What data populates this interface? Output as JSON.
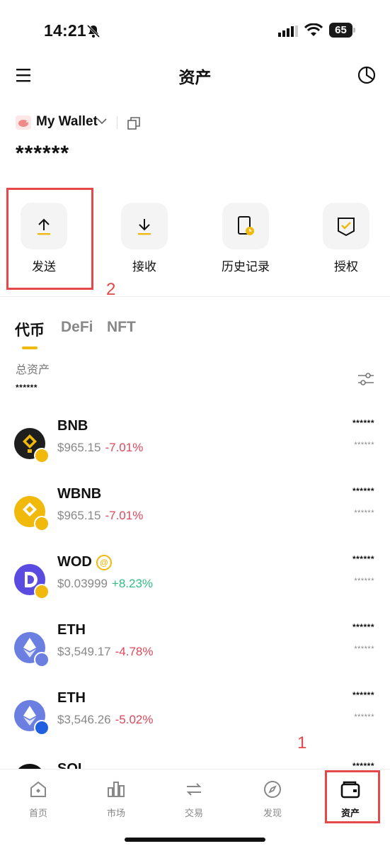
{
  "status_bar": {
    "time": "14:21",
    "battery": "65"
  },
  "header": {
    "title": "资产"
  },
  "wallet": {
    "name": "My Wallet",
    "balance": "******"
  },
  "actions": [
    {
      "label": "发送",
      "icon": "arrow-up-icon"
    },
    {
      "label": "接收",
      "icon": "arrow-down-icon"
    },
    {
      "label": "历史记录",
      "icon": "history-icon"
    },
    {
      "label": "授权",
      "icon": "authorize-icon"
    }
  ],
  "annotations": {
    "marker_1": "1",
    "marker_2": "2"
  },
  "tabs": [
    {
      "label": "代币",
      "active": true
    },
    {
      "label": "DeFi",
      "active": false
    },
    {
      "label": "NFT",
      "active": false
    }
  ],
  "total": {
    "label": "总资产",
    "value": "******"
  },
  "tokens": [
    {
      "name": "BNB",
      "price": "$965.15",
      "change": "-7.01%",
      "balance": "******",
      "value": "******",
      "color": "#1e1e1e"
    },
    {
      "name": "WBNB",
      "price": "$965.15",
      "change": "-7.01%",
      "balance": "******",
      "value": "******",
      "color": "#f0b90b"
    },
    {
      "name": "WOD",
      "price": "$0.03999",
      "change": "+8.23%",
      "balance": "******",
      "value": "******",
      "color": "#5b4be0",
      "badge": "@"
    },
    {
      "name": "ETH",
      "price": "$3,549.17",
      "change": "-4.78%",
      "balance": "******",
      "value": "******",
      "color": "#6b7fe0"
    },
    {
      "name": "ETH",
      "price": "$3,546.26",
      "change": "-5.02%",
      "balance": "******",
      "value": "******",
      "color": "#6b7fe0"
    },
    {
      "name": "SOL",
      "balance": "******"
    }
  ],
  "bottom_nav": [
    {
      "label": "首页",
      "active": false
    },
    {
      "label": "市场",
      "active": false
    },
    {
      "label": "交易",
      "active": false
    },
    {
      "label": "发现",
      "active": false
    },
    {
      "label": "资产",
      "active": true
    }
  ],
  "colors": {
    "accent": "#f0b90b",
    "negative": "#e0475a",
    "positive": "#2fbd85",
    "annotation_red": "#e44848"
  }
}
